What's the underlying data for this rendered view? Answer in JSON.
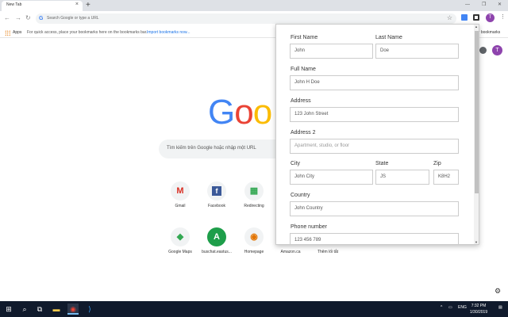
{
  "browser": {
    "tab_title": "New Tab",
    "tab_close": "×",
    "new_tab": "+",
    "omnibox_placeholder": "Search Google or type a URL",
    "profile_initial": "T"
  },
  "bookmarks_bar": {
    "apps_label": "Apps",
    "hint_text": "For quick access, place your bookmarks here on the bookmarks bar.",
    "import_link": "Import bookmarks now...",
    "right_text": "er bookmarks"
  },
  "ntp": {
    "search_placeholder": "Tìm kiếm trên Google hoặc nhập một URL",
    "profile_initial": "T",
    "tiles": [
      {
        "label": "Gmail",
        "glyph": "M",
        "color": "#d93025"
      },
      {
        "label": "Facebook",
        "glyph": "f",
        "color": "#3b5998"
      },
      {
        "label": "Redirecting",
        "glyph": "▦",
        "color": "#e37400"
      },
      {
        "label": "Google Maps",
        "glyph": "◆",
        "color": "#34a853"
      },
      {
        "label": "buschat.eastus...",
        "glyph": "A",
        "color": "#ffffff"
      },
      {
        "label": "Homepage",
        "glyph": "◉",
        "color": "#e37400"
      },
      {
        "label": "Amazon.ca",
        "glyph": "",
        "color": "#f1f3f4"
      },
      {
        "label": "Thêm lối tắt",
        "glyph": "",
        "color": "#ffffff"
      }
    ]
  },
  "form": {
    "first_name": {
      "label": "First Name",
      "value": "John"
    },
    "last_name": {
      "label": "Last Name",
      "value": "Doe"
    },
    "full_name": {
      "label": "Full Name",
      "value": "John H Doe"
    },
    "address": {
      "label": "Address",
      "value": "123 John Street"
    },
    "address2": {
      "label": "Address 2",
      "placeholder": "Apartment, studio, or floor"
    },
    "city": {
      "label": "City",
      "value": "John City"
    },
    "state": {
      "label": "State",
      "value": "JS"
    },
    "zip": {
      "label": "Zip",
      "value": "K8H2"
    },
    "country": {
      "label": "Country",
      "value": "John Country"
    },
    "phone": {
      "label": "Phone number",
      "value": "123 456 789"
    }
  },
  "taskbar": {
    "language": "ENG",
    "time": "7:32 PM",
    "date": "1/30/2019"
  },
  "colors": {
    "google_blue": "#4285f4",
    "google_red": "#ea4335",
    "google_yellow": "#fbbc05",
    "google_green": "#34a853",
    "profile": "#8e44ad",
    "taskbar": "#101a2c"
  }
}
